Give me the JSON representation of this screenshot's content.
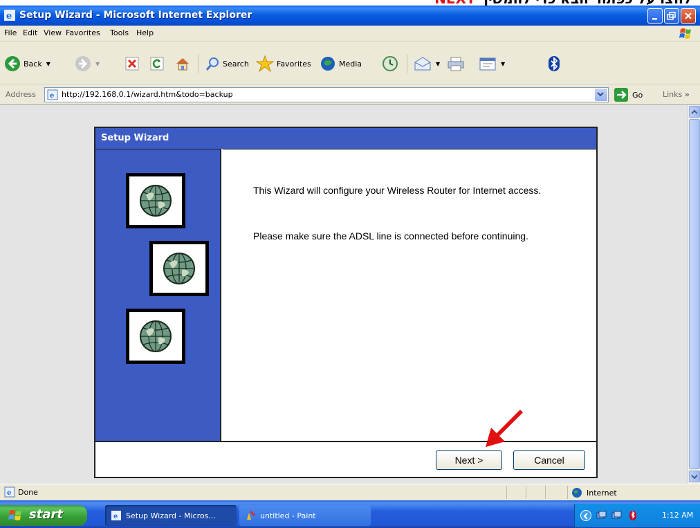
{
  "caption": {
    "text_before": "לחצו על כפתור הבא כדי להמשיך",
    "text_red": "NEXT"
  },
  "window": {
    "title": "Setup Wizard - Microsoft Internet Explorer"
  },
  "menu": [
    "File",
    "Edit",
    "View",
    "Favorites",
    "Tools",
    "Help"
  ],
  "toolbar": {
    "back_label": "Back",
    "search_label": "Search",
    "favorites_label": "Favorites",
    "media_label": "Media"
  },
  "address": {
    "label": "Address",
    "url": "http://192.168.0.1/wizard.htm&todo=backup",
    "go_label": "Go",
    "links_label": "Links"
  },
  "wizard": {
    "title": "Setup Wizard",
    "message_1": "This Wizard will configure your Wireless Router for Internet access.",
    "message_2": "Please make sure the ADSL line is connected before continuing.",
    "next_label": "Next >",
    "cancel_label": "Cancel"
  },
  "status": {
    "text": "Done",
    "zone": "Internet"
  },
  "taskbar": {
    "start_label": "start",
    "tasks": [
      {
        "label": "Setup Wizard - Micros..."
      },
      {
        "label": "untitled - Paint"
      }
    ],
    "clock": "1:12 AM"
  },
  "colors": {
    "title_blue": "#0550d8",
    "wizard_blue": "#3c5cc4",
    "arrow_red": "#e01010",
    "taskbar_blue": "#245edb",
    "start_green": "#37a037"
  }
}
